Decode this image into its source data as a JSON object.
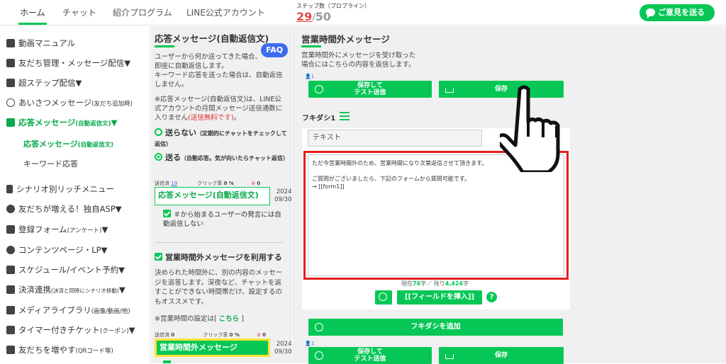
{
  "header": {
    "tabs": [
      "ホーム",
      "チャット",
      "紹介プログラム",
      "LINE公式アカウント"
    ],
    "step_label": "ステップ数（プロプライン）",
    "step_current": "29",
    "step_sep": "/",
    "step_max": "50",
    "feedback_button": "ご意見を送る"
  },
  "sidebar": {
    "items": [
      {
        "label": "動画マニュアル",
        "icon": "video-icon"
      },
      {
        "label": "友だち管理・メッセージ配信▼",
        "icon": "contacts-icon"
      },
      {
        "label": "超ステップ配信▼",
        "icon": "step-icon"
      },
      {
        "label": "あいさつメッセージ",
        "sub": "(友だち追加時)",
        "icon": "hand-icon"
      },
      {
        "label": "応答メッセージ",
        "sub": "(自動返信文)",
        "tail": "▼",
        "icon": "reply-icon"
      },
      {
        "label": "シナリオ別リッチメニュー",
        "icon": "phone-icon"
      },
      {
        "label": "友だちが増える！独自ASP▼",
        "icon": "chat-icon"
      },
      {
        "label": "登録フォーム",
        "sub": "(アンケート)",
        "tail": "▼",
        "icon": "list-icon"
      },
      {
        "label": "コンテンツページ・LP▼",
        "icon": "globe-icon"
      },
      {
        "label": "スケジュール/イベント予約▼",
        "icon": "calendar-icon"
      },
      {
        "label": "決済連携",
        "sub": "(決済と同時にシナリオ移動)",
        "tail": "▼",
        "icon": "card-icon"
      },
      {
        "label": "メディアライブラリ",
        "sub": "(画像/動画/他)",
        "icon": "folder-icon"
      },
      {
        "label": "タイマー付きチケット",
        "sub": "(クーポン)",
        "tail": "▼",
        "icon": "ticket-icon"
      },
      {
        "label": "友だちを増やす",
        "sub": "(QRコード等)",
        "icon": "add-user-icon"
      }
    ],
    "subitems": [
      "応答メッセージ",
      "(自動返信文)",
      "キーワード応答"
    ]
  },
  "middle": {
    "title": "応答メッセージ(自動返信文)",
    "faq": "FAQ",
    "intro1": "ユーザーから何か送ってきた場合、即座に自動返信します。",
    "intro2": "キーワード応答を送った場合は、自動返信しません。",
    "note_prefix": "※応答メッセージ(自動返信文)は、LINE公式アカウントの月間メッセージ送信通数に入りません",
    "note_free": "(送信無料です)",
    "note_suffix": "。",
    "radio_off": "送らない",
    "radio_off_sub": "（定期的にチャットをチェックして返信）",
    "radio_on": "送る",
    "radio_on_sub": "（自動応答。気が向いたらチャット返信）",
    "stats1": {
      "sent_label": "送信済",
      "sent": "19",
      "click_label": "クリック率",
      "click": "0 %",
      "block": "0"
    },
    "msg1": "応答メッセージ(自動返信文)",
    "date1_year": "2024",
    "date1_day": "09/30",
    "hash_check": "＃から始まるユーザーの発言には自動返信しない",
    "off_hours_check": "営業時間外メッセージを利用する",
    "off_hours_desc": "決められた時間外に、別の内容のメッセージを返答します。深夜など、チャットを返すことができない時間帯だけ、設定するのもオススメです。",
    "hours_setting": "※営業時間の設定は[",
    "hours_link": "こちら",
    "hours_close": "]",
    "stats2": {
      "sent_label": "送信済",
      "sent": "0",
      "click_label": "クリック率",
      "click": "0 %",
      "block": "0"
    },
    "msg2": "営業時間外メッセージ",
    "date2_year": "2024",
    "date2_day": "09/30"
  },
  "right": {
    "title": "営業時間外メッセージ",
    "desc1": "営業時間外にメッセージを受け取った",
    "desc2": "場合にはこちらの内容を返信します。",
    "person_count": "1",
    "save_test_l1": "保存して",
    "save_test_l2": "テスト送信",
    "save": "保存",
    "fukidashi": "フキダシ1",
    "text_type": "テキスト",
    "message_lines": [
      "ただ今営業時間外のため、営業時間になり次第返信させて頂きます。",
      "",
      "ご質問がございましたら、下記のフォームから質問可能です。",
      "→ [[form1]]"
    ],
    "counter_prefix": "現在",
    "counter_used": "76",
    "counter_mid": "字／ 残り",
    "counter_left": "4,424",
    "counter_suffix": "字",
    "insert_field": "[[フィールドを挿入]]",
    "help": "?",
    "add_fukidashi": "フキダシを追加",
    "person_count2": "1"
  },
  "colors": {
    "accent": "#06c755",
    "alert": "#e41e1e",
    "faq": "#3b6cf0",
    "highlight": "#ffe33a"
  }
}
